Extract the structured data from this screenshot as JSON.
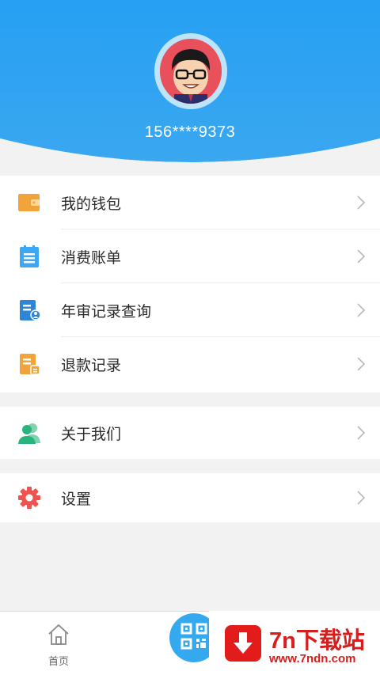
{
  "profile": {
    "phone": "156****9373"
  },
  "menu_group_1": [
    {
      "label": "我的钱包",
      "icon": "wallet-icon",
      "color": "#f2a33a"
    },
    {
      "label": "消费账单",
      "icon": "bill-icon",
      "color": "#3ea7f3"
    },
    {
      "label": "年审记录查询",
      "icon": "inspection-record-icon",
      "color": "#2f86d6"
    },
    {
      "label": "退款记录",
      "icon": "refund-record-icon",
      "color": "#f2a33a"
    }
  ],
  "menu_group_2": [
    {
      "label": "关于我们",
      "icon": "users-icon",
      "color": "#29b47e"
    }
  ],
  "menu_group_3": [
    {
      "label": "设置",
      "icon": "gear-icon",
      "color": "#ef5350"
    }
  ],
  "tabbar": {
    "home_label": "首页",
    "center_icon": "qr-code-icon"
  },
  "watermark": {
    "title": "7n下载站",
    "url": "www.7ndn.com"
  },
  "colors": {
    "header_blue": "#2c9df0",
    "accent_red": "#d81d1d"
  }
}
